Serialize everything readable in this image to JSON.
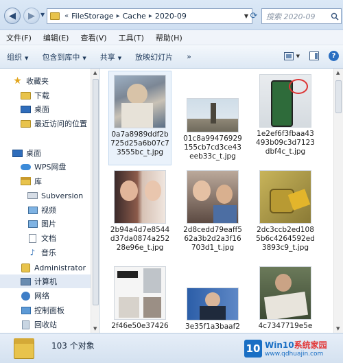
{
  "address": {
    "crumbs": [
      "FileStorage",
      "Cache",
      "2020-09"
    ],
    "prefix": "«",
    "sep": "▸"
  },
  "search": {
    "placeholder": "搜索 2020-09"
  },
  "menu": [
    "文件(F)",
    "编辑(E)",
    "查看(V)",
    "工具(T)",
    "帮助(H)"
  ],
  "commands": {
    "organize": "组织",
    "include": "包含到库中",
    "share": "共享",
    "slideshow": "放映幻灯片",
    "more": "»"
  },
  "nav": {
    "favorites": "收藏夹",
    "downloads": "下载",
    "desktop1": "桌面",
    "recent": "最近访问的位置",
    "desktop2": "桌面",
    "wps": "WPS网盘",
    "library": "库",
    "subversion": "Subversion",
    "video": "视频",
    "pictures": "图片",
    "documents": "文档",
    "music": "音乐",
    "admin": "Administrator",
    "computer": "计算机",
    "network": "网络",
    "control": "控制面板",
    "recycle": "回收站"
  },
  "files": [
    {
      "name": "0a7a8989ddf2b725d25a6b07c73555bc_t.jpg"
    },
    {
      "name": "01c8a99476929155cb7cd3ce43eeb33c_t.jpg"
    },
    {
      "name": "1e2ef6f3fbaa43493b09c3d7123dbf4c_t.jpg"
    },
    {
      "name": "2b94a4d7e8544d37da0874a25228e96e_t.jpg"
    },
    {
      "name": "2d8cedd79eaff562a3b2d2a3f16703d1_t.jpg"
    },
    {
      "name": "2dc3ccb2ed1085b6c4264592ed3893c9_t.jpg"
    },
    {
      "name": "2f46e50e37426"
    },
    {
      "name": "3e35f1a3baaf2"
    },
    {
      "name": "4c7347719e5e"
    }
  ],
  "status": {
    "count": "103 个对象"
  },
  "watermark": {
    "mark": "10",
    "line1_a": "Win10",
    "line1_b": "系统家园",
    "line2": "www.qdhuajin.com"
  }
}
